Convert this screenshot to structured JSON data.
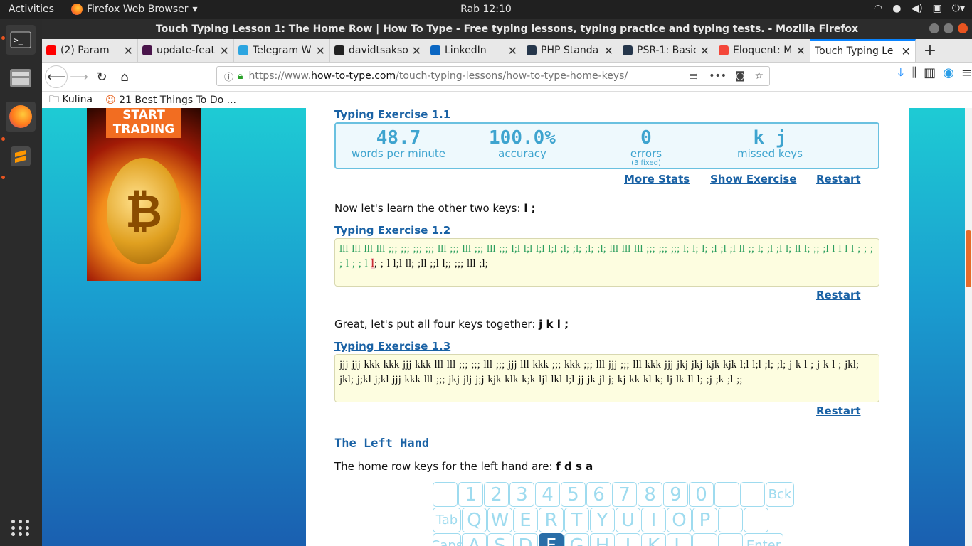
{
  "topbar": {
    "activities": "Activities",
    "app": "Firefox Web Browser",
    "clock": "Rab 12:10"
  },
  "window": {
    "title": "Touch Typing Lesson 1: The Home Row | How To Type - Free typing lessons, typing practice and typing tests. - Mozilla Firefox"
  },
  "tabs": [
    {
      "label": "(2) Param",
      "color": "#ff0000",
      "icon": "youtube-icon"
    },
    {
      "label": "update-feat",
      "color": "#4a154b",
      "icon": "slack-icon"
    },
    {
      "label": "Telegram W",
      "color": "#2ca5e0",
      "icon": "telegram-icon"
    },
    {
      "label": "davidtsakso",
      "color": "#222222",
      "icon": "github-icon"
    },
    {
      "label": "LinkedIn",
      "color": "#0a66c2",
      "icon": "linkedin-icon"
    },
    {
      "label": "PHP Standa",
      "color": "#25364b",
      "icon": "php-fig-icon"
    },
    {
      "label": "PSR-1: Basic",
      "color": "#25364b",
      "icon": "php-fig-icon"
    },
    {
      "label": "Eloquent: M",
      "color": "#f4473a",
      "icon": "laravel-icon"
    },
    {
      "label": "Touch Typing Le",
      "color": "#ffffff",
      "icon": "page-icon"
    }
  ],
  "urlbar": {
    "prefix": "https://www.",
    "domain": "how-to-type.com",
    "path": "/touch-typing-lessons/how-to-type-home-keys/"
  },
  "bookmarks": [
    {
      "label": "Kulina"
    },
    {
      "label": "21 Best Things To Do ..."
    }
  ],
  "ad": {
    "text": "START TRADING"
  },
  "exercise1": {
    "title": "Typing Exercise 1.1",
    "stats": [
      {
        "value": "48.7",
        "label": "words per minute"
      },
      {
        "value": "100.0%",
        "label": "accuracy"
      },
      {
        "value": "0",
        "label": "errors",
        "note": "(3 fixed)"
      },
      {
        "value": "k j",
        "label": "missed keys"
      }
    ],
    "more": "More Stats",
    "show": "Show Exercise",
    "restart": "Restart"
  },
  "para2": {
    "text": "Now let's learn the other two keys:",
    "keys": "l ;"
  },
  "exercise2": {
    "title": "Typing Exercise 1.2",
    "done": "lll lll lll lll ;;; ;;; ;;; ;;; lll ;;; lll ;;; lll ;;; l;l l;l l;l l;l ;l; ;l; ;l; ;l; lll lll lll ;;; ;;; ;;; l; l; l; ;l ;l ;l ll ;; l; ;l ;l l; ll l; ;; ;l l l l l ; ; ; ; l ; ; l ",
    "current": "l",
    "rest": "; ; l l;l ll; ;ll ;;l l;; ;;; lll ;l;",
    "restart": "Restart"
  },
  "para3": {
    "text": "Great, let's put all four keys together:",
    "keys": "j k l ;"
  },
  "exercise3": {
    "title": "Typing Exercise 1.3",
    "text": "jjj jjj kkk kkk jjj kkk lll lll ;;; ;;; lll ;;; jjj lll kkk ;;; kkk ;;; lll jjj ;;; lll kkk jjj jkj jkj kjk kjk l;l l;l ;l; ;l; j k l ; j k l ; jkl; jkl; j;kl j;kl jjj kkk lll ;;; jkj jlj j;j kjk klk k;k ljl lkl l;l jj jk jl j; kj kk kl k; lj lk ll l; ;j ;k ;l ;;",
    "restart": "Restart"
  },
  "lefthand": {
    "heading": "The Left Hand",
    "text": "The home row keys for the left hand are:",
    "keys": "f d s a"
  },
  "keyboard": {
    "row1": [
      "",
      "1",
      "2",
      "3",
      "4",
      "5",
      "6",
      "7",
      "8",
      "9",
      "0",
      "",
      "",
      "Bck"
    ],
    "row2": [
      "Tab",
      "Q",
      "W",
      "E",
      "R",
      "T",
      "Y",
      "U",
      "I",
      "O",
      "P",
      "",
      ""
    ],
    "row3": [
      "Caps",
      "A",
      "S",
      "D",
      "F",
      "G",
      "H",
      "J",
      "K",
      "L",
      "",
      "",
      "Enter"
    ],
    "highlight": "F"
  }
}
